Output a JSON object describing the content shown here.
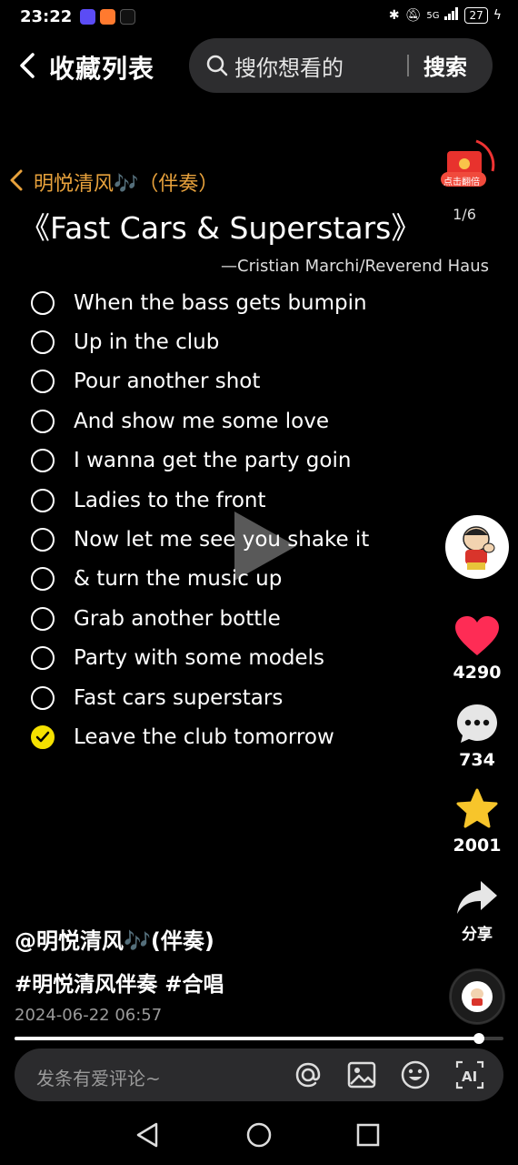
{
  "status_bar": {
    "time": "23:22",
    "network": "5G",
    "battery": "27"
  },
  "header": {
    "title": "收藏列表",
    "search_placeholder": "搜你想看的",
    "search_button": "搜索"
  },
  "post": {
    "author_line": "明悦清风🎶（伴奏）",
    "song_title": "《Fast Cars & Superstars》",
    "song_artist": "—Cristian Marchi/Reverend Haus",
    "gift_label": "点击翻倍",
    "image_counter": "1/6",
    "lyrics": [
      {
        "text": "When the bass gets bumpin",
        "checked": false
      },
      {
        "text": "Up in the club",
        "checked": false
      },
      {
        "text": "Pour another shot",
        "checked": false
      },
      {
        "text": "And show me some love",
        "checked": false
      },
      {
        "text": "I wanna get the party goin",
        "checked": false
      },
      {
        "text": "Ladies to the front",
        "checked": false
      },
      {
        "text": "Now let me see you shake it",
        "checked": false
      },
      {
        "text": "& turn the music up",
        "checked": false
      },
      {
        "text": "Grab another bottle",
        "checked": false
      },
      {
        "text": "Party with some models",
        "checked": false
      },
      {
        "text": "Fast cars superstars",
        "checked": false
      },
      {
        "text": "Leave the club tomorrow",
        "checked": true
      }
    ]
  },
  "side_actions": {
    "likes": "4290",
    "comments": "734",
    "favorites": "2001",
    "share": "分享"
  },
  "info": {
    "user_handle": "@明悦清风🎶(伴奏)",
    "hashtags": "#明悦清风伴奏 #合唱",
    "date": "2024-06-22 06:57",
    "progress": 0.95
  },
  "comment_bar": {
    "placeholder": "发条有爱评论~"
  },
  "colors": {
    "accent_orange": "#e8a23c",
    "like_red": "#fe2c55",
    "star_yellow": "#f7c52b",
    "check_yellow": "#f5e100"
  }
}
